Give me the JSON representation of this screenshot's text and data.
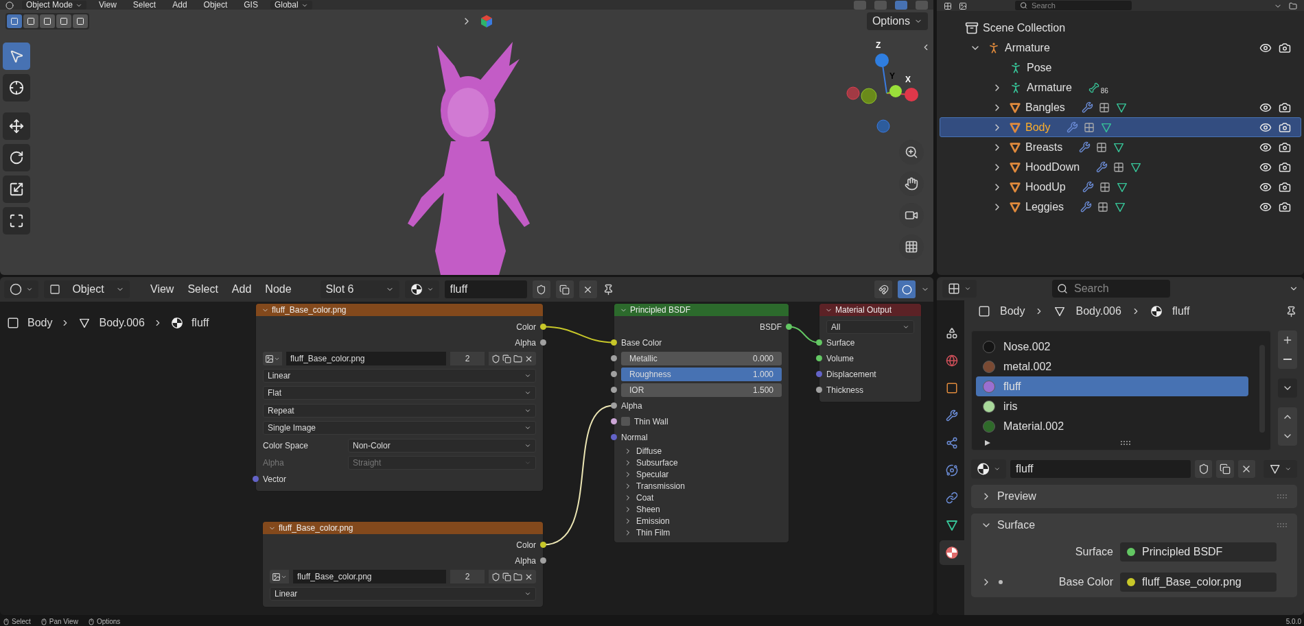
{
  "viewport": {
    "header": {
      "mode": "Object Mode",
      "menus": [
        "View",
        "Select",
        "Add",
        "Object",
        "GIS"
      ],
      "orientation": "Global"
    },
    "shading": [
      {
        "selected": false
      },
      {
        "selected": false
      },
      {
        "selected": true
      },
      {
        "selected": false
      }
    ],
    "select_modes": [
      {
        "selected": true
      },
      {
        "selected": false
      },
      {
        "selected": false
      },
      {
        "selected": false
      },
      {
        "selected": false
      }
    ],
    "options": "Options",
    "tools": [
      {
        "kind": "select",
        "selected": true
      },
      {
        "kind": "cursor",
        "selected": false
      },
      {
        "kind": "move",
        "selected": false
      },
      {
        "kind": "rotate",
        "selected": false
      },
      {
        "kind": "scale",
        "selected": false
      },
      {
        "kind": "transform",
        "selected": false
      }
    ],
    "gizmo": {
      "z": "Z",
      "y": "Y",
      "x": "X"
    }
  },
  "outliner": {
    "search": {
      "placeholder": "Search"
    },
    "root": {
      "label": "Scene Collection",
      "children": [
        {
          "label": "Armature",
          "kind": "armature",
          "expanded": true,
          "selected": false,
          "children": [
            {
              "label": "Pose",
              "kind": "pose",
              "selected": false
            },
            {
              "label": "Armature",
              "kind": "armature_data",
              "expanded": false,
              "selected": false,
              "badge": "86"
            },
            {
              "label": "Bangles",
              "kind": "mesh",
              "expanded": false,
              "selected": false
            },
            {
              "label": "Body",
              "kind": "mesh",
              "expanded": false,
              "selected": true
            },
            {
              "label": "Breasts",
              "kind": "mesh",
              "expanded": false,
              "selected": false
            },
            {
              "label": "HoodDown",
              "kind": "mesh",
              "expanded": false,
              "selected": false
            },
            {
              "label": "HoodUp",
              "kind": "mesh",
              "expanded": false,
              "selected": false
            },
            {
              "label": "Leggies",
              "kind": "mesh",
              "expanded": false,
              "selected": false
            }
          ]
        }
      ]
    }
  },
  "node_editor": {
    "header": {
      "object": "Object",
      "menus": [
        "View",
        "Select",
        "Add",
        "Node"
      ],
      "slot": "Slot 6",
      "material": "fluff"
    },
    "breadcrumb": [
      "Body",
      "Body.006",
      "fluff"
    ],
    "nodes": [
      {
        "kind": "image",
        "title": "fluff_Base_color.png",
        "outputs": [
          {
            "label": "Color",
            "color": "#c7c729"
          },
          {
            "label": "Alpha",
            "color": "#a1a1a1"
          }
        ],
        "image": "fluff_Base_color.png",
        "users": "2",
        "dropdowns": [
          "Linear",
          "Flat",
          "Repeat",
          "Single Image"
        ],
        "fields": [
          {
            "label": "Color Space",
            "value": "Non-Color",
            "disabled": false
          },
          {
            "label": "Alpha",
            "value": "Straight",
            "disabled": true
          }
        ],
        "inputs": [
          {
            "label": "Vector",
            "color": "#6363c7"
          }
        ]
      },
      {
        "kind": "image",
        "title": "fluff_Base_color.png",
        "outputs": [
          {
            "label": "Color",
            "color": "#c7c729"
          },
          {
            "label": "Alpha",
            "color": "#a1a1a1"
          }
        ],
        "image": "fluff_Base_color.png",
        "users": "2",
        "dropdowns": [
          "Linear"
        ]
      },
      {
        "kind": "bsdf",
        "title": "Principled BSDF",
        "outputs": [
          {
            "label": "BSDF",
            "color": "#63c763"
          }
        ],
        "inputs": [
          {
            "kind": "socket",
            "label": "Base Color",
            "color": "#c7c729"
          },
          {
            "kind": "slider",
            "label": "Metallic",
            "value": "0.000",
            "level": 0,
            "color": "#a1a1a1"
          },
          {
            "kind": "slider",
            "label": "Roughness",
            "value": "1.000",
            "level": 1,
            "color": "#a1a1a1"
          },
          {
            "kind": "field",
            "label": "IOR",
            "value": "1.500",
            "color": "#a1a1a1"
          },
          {
            "kind": "socket",
            "label": "Alpha",
            "color": "#a1a1a1"
          },
          {
            "kind": "checkbox",
            "label": "Thin Wall",
            "checked": false,
            "color": "#cca6d6"
          },
          {
            "kind": "socket",
            "label": "Normal",
            "color": "#6363c7"
          }
        ],
        "panels": [
          {
            "label": "Diffuse",
            "expanded": false
          },
          {
            "label": "Subsurface",
            "expanded": false
          },
          {
            "label": "Specular",
            "expanded": false
          },
          {
            "label": "Transmission",
            "expanded": false
          },
          {
            "label": "Coat",
            "expanded": false
          },
          {
            "label": "Sheen",
            "expanded": false
          },
          {
            "label": "Emission",
            "expanded": false
          },
          {
            "label": "Thin Film",
            "expanded": false
          }
        ]
      },
      {
        "kind": "output",
        "title": "Material Output",
        "target": "All",
        "inputs": [
          {
            "label": "Surface",
            "color": "#63c763"
          },
          {
            "label": "Volume",
            "color": "#63c763"
          },
          {
            "label": "Displacement",
            "color": "#6363c7"
          },
          {
            "label": "Thickness",
            "color": "#a1a1a1"
          }
        ]
      }
    ]
  },
  "properties": {
    "search": {
      "placeholder": "Search"
    },
    "tabs": [
      {
        "kind": "scene",
        "selected": false
      },
      {
        "kind": "world",
        "selected": false
      },
      {
        "kind": "object",
        "selected": false
      },
      {
        "kind": "modifiers",
        "selected": false
      },
      {
        "kind": "particles",
        "selected": false
      },
      {
        "kind": "physics",
        "selected": false
      },
      {
        "kind": "constraints",
        "selected": false
      },
      {
        "kind": "data",
        "selected": false
      },
      {
        "kind": "material",
        "selected": true
      }
    ],
    "breadcrumb": [
      "Body",
      "Body.006",
      "fluff"
    ],
    "slots": [
      {
        "name": "Nose.002",
        "color": "#151515",
        "selected": false
      },
      {
        "name": "metal.002",
        "color": "#7a4a33",
        "selected": false
      },
      {
        "name": "fluff",
        "color": "#9a6fd0",
        "selected": true
      },
      {
        "name": "iris",
        "color": "#a8d89a",
        "selected": false
      },
      {
        "name": "Material.002",
        "color": "#2f6a2a",
        "selected": false
      }
    ],
    "material": "fluff",
    "panels": [
      {
        "title": "Preview",
        "expanded": false
      },
      {
        "title": "Surface",
        "expanded": true,
        "rows": [
          {
            "label": "Surface",
            "value": "Principled BSDF",
            "color": "#63c763",
            "expandable": false
          },
          {
            "label": "Base Color",
            "value": "fluff_Base_color.png",
            "color": "#c7c729",
            "expandable": true
          }
        ]
      }
    ]
  },
  "status_bar": [
    "Select",
    "Pan View",
    "Options"
  ],
  "version": "5.0.0"
}
